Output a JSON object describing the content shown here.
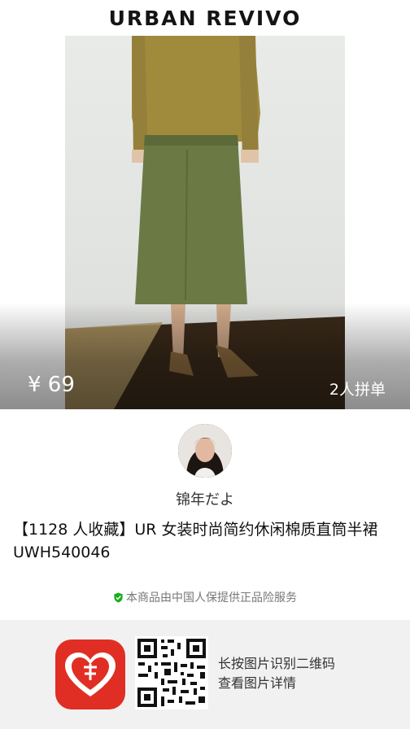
{
  "brand": {
    "name": "URBAN REVIVO"
  },
  "product": {
    "price": "¥ 69",
    "group_buy": "2人拼单",
    "title": "【1128 人收藏】UR 女装时尚简约休闲棉质直筒半裙 UWH540046"
  },
  "seller": {
    "name": "锦年だよ"
  },
  "guarantee": {
    "text": "本商品由中国人保提供正品险服务",
    "icon": "shield-check-icon"
  },
  "footer": {
    "app_icon": "pinduoduo-app-logo",
    "qr_icon": "qr-code",
    "tip_line1": "长按图片识别二维码",
    "tip_line2": "查看图片详情"
  },
  "colors": {
    "brand_text": "#141414",
    "accent_red": "#e02e24",
    "guarantee_green": "#1aad19",
    "skirt_green": "#6b7a45",
    "sweater_mustard": "#a08a3c"
  }
}
